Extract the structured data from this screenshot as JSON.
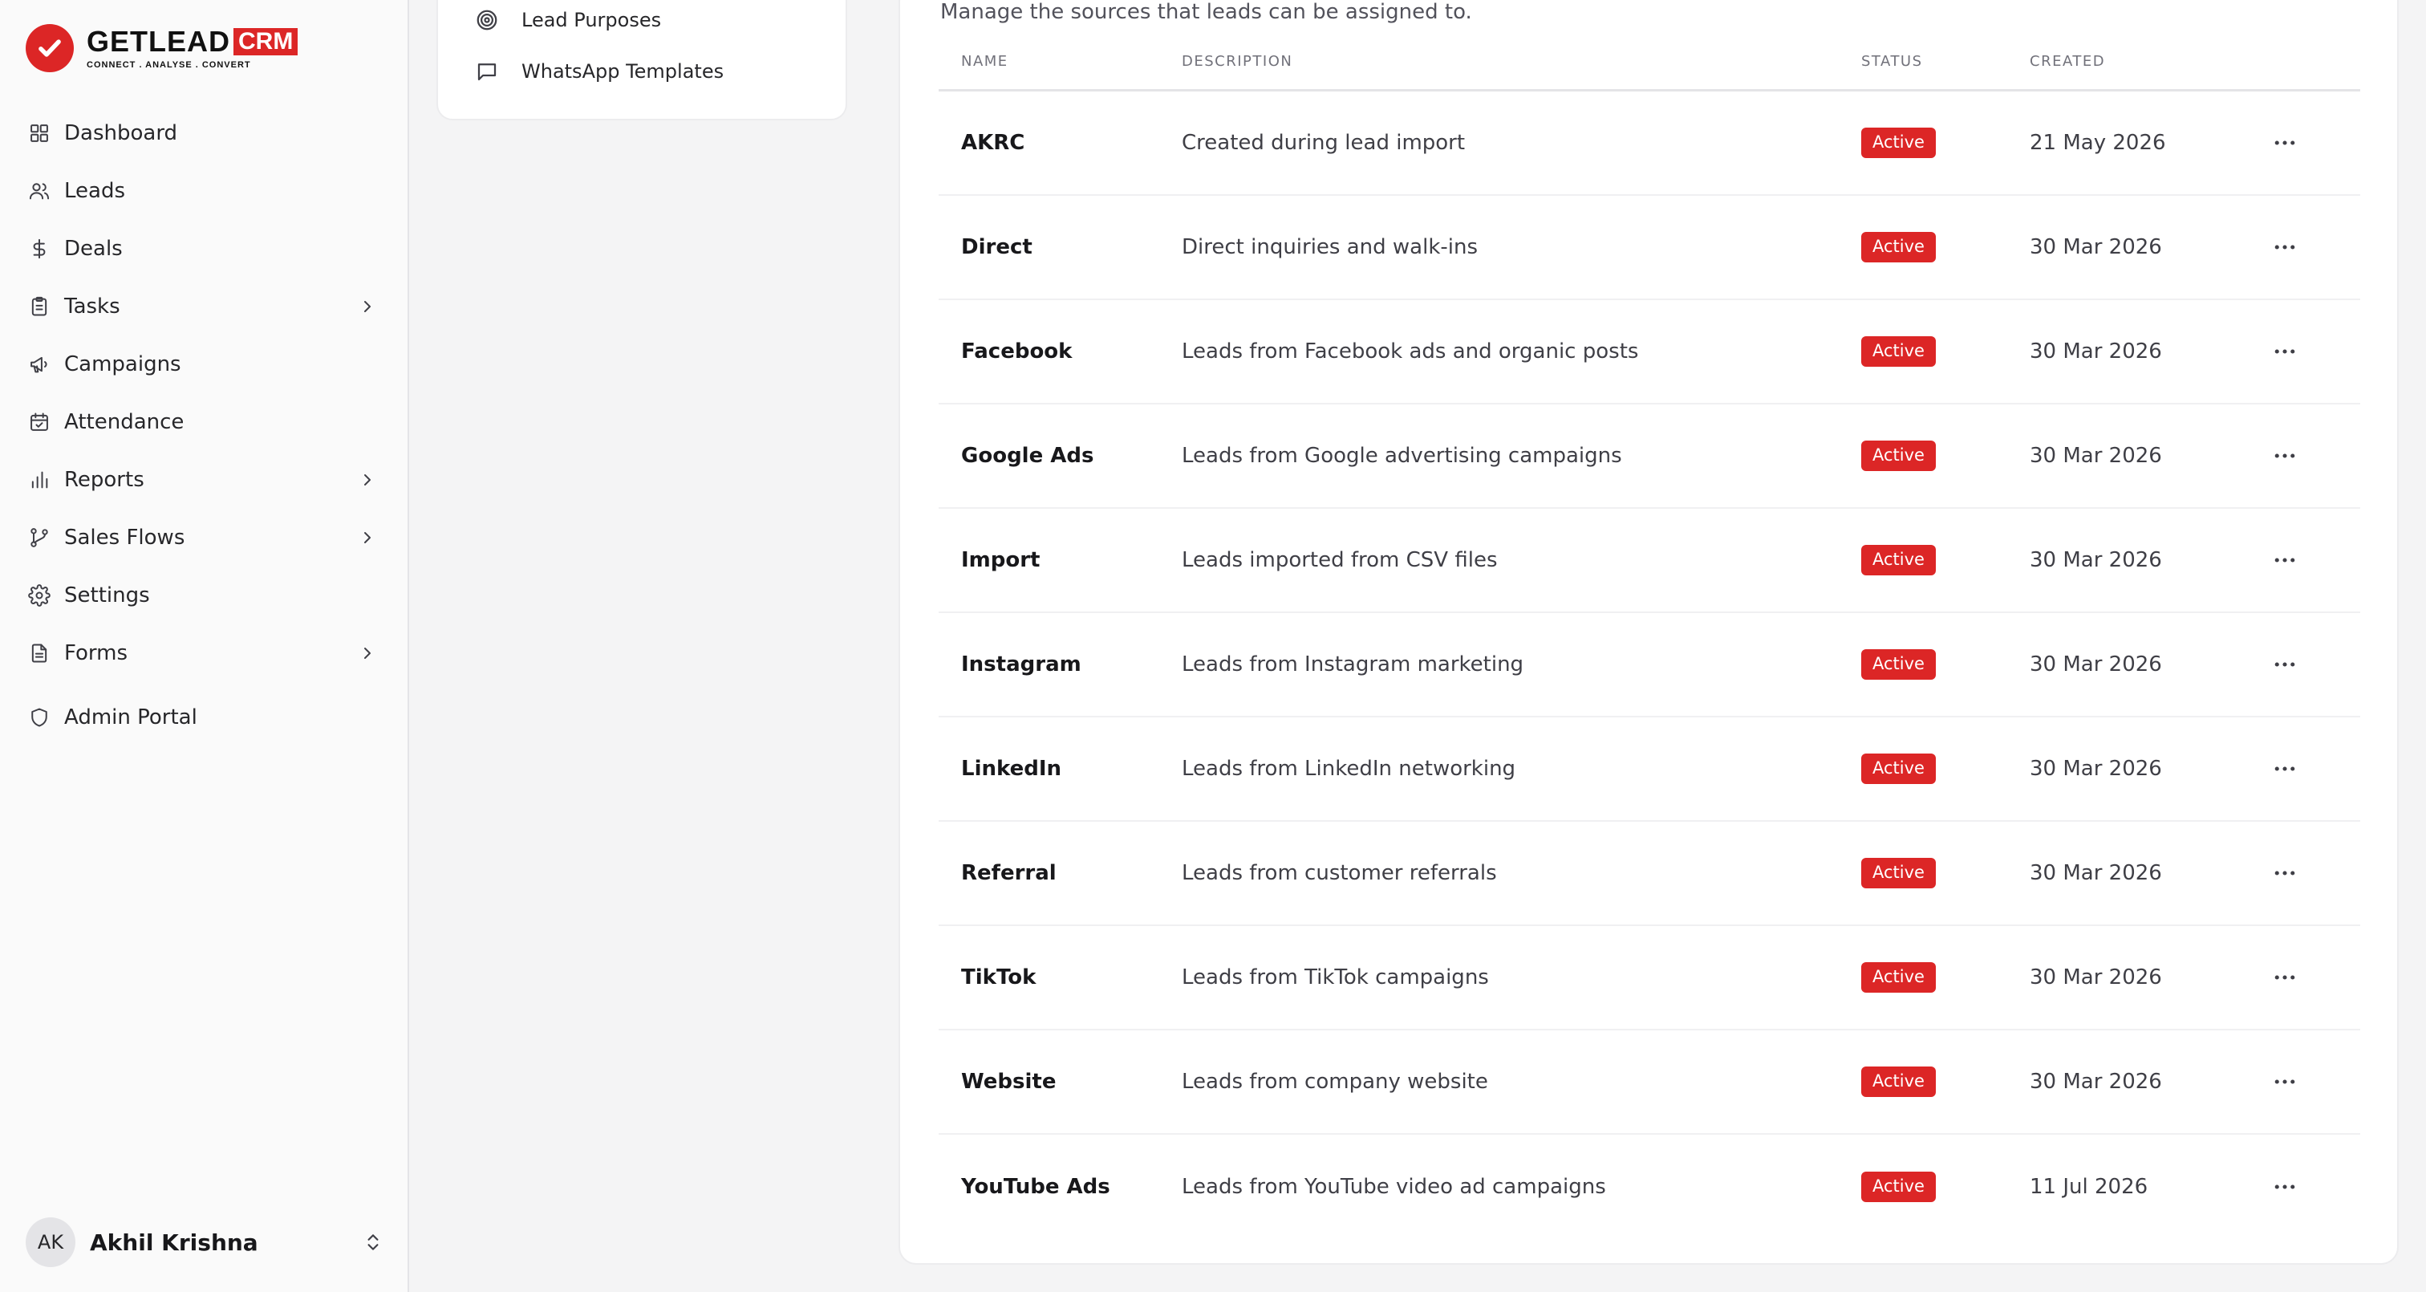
{
  "brand": {
    "name": "GETLEAD",
    "crm": "CRM",
    "tagline": "CONNECT . ANALYSE . CONVERT"
  },
  "sidebar": {
    "items": [
      {
        "label": "Dashboard",
        "icon": "grid-icon",
        "chevron": false
      },
      {
        "label": "Leads",
        "icon": "users-icon",
        "chevron": false
      },
      {
        "label": "Deals",
        "icon": "dollar-icon",
        "chevron": false
      },
      {
        "label": "Tasks",
        "icon": "clipboard-icon",
        "chevron": true
      },
      {
        "label": "Campaigns",
        "icon": "megaphone-icon",
        "chevron": false
      },
      {
        "label": "Attendance",
        "icon": "calendar-check-icon",
        "chevron": false
      },
      {
        "label": "Reports",
        "icon": "bar-chart-icon",
        "chevron": true
      },
      {
        "label": "Sales Flows",
        "icon": "git-branch-icon",
        "chevron": true
      },
      {
        "label": "Settings",
        "icon": "gear-icon",
        "chevron": false
      },
      {
        "label": "Forms",
        "icon": "document-icon",
        "chevron": true
      }
    ],
    "admin_label": "Admin Portal",
    "user": {
      "initials": "AK",
      "name": "Akhil Krishna"
    }
  },
  "subnav": {
    "items": [
      {
        "label": "Lead Purposes",
        "icon": "target-icon"
      },
      {
        "label": "WhatsApp Templates",
        "icon": "message-square-icon"
      }
    ]
  },
  "main": {
    "subtitle": "Manage the sources that leads can be assigned to.",
    "columns": {
      "name": "Name",
      "description": "Description",
      "status": "Status",
      "created": "Created"
    },
    "rows": [
      {
        "name": "AKRC",
        "description": "Created during lead import",
        "status": "Active",
        "created": "21 May 2026"
      },
      {
        "name": "Direct",
        "description": "Direct inquiries and walk-ins",
        "status": "Active",
        "created": "30 Mar 2026"
      },
      {
        "name": "Facebook",
        "description": "Leads from Facebook ads and organic posts",
        "status": "Active",
        "created": "30 Mar 2026"
      },
      {
        "name": "Google Ads",
        "description": "Leads from Google advertising campaigns",
        "status": "Active",
        "created": "30 Mar 2026"
      },
      {
        "name": "Import",
        "description": "Leads imported from CSV files",
        "status": "Active",
        "created": "30 Mar 2026"
      },
      {
        "name": "Instagram",
        "description": "Leads from Instagram marketing",
        "status": "Active",
        "created": "30 Mar 2026"
      },
      {
        "name": "LinkedIn",
        "description": "Leads from LinkedIn networking",
        "status": "Active",
        "created": "30 Mar 2026"
      },
      {
        "name": "Referral",
        "description": "Leads from customer referrals",
        "status": "Active",
        "created": "30 Mar 2026"
      },
      {
        "name": "TikTok",
        "description": "Leads from TikTok campaigns",
        "status": "Active",
        "created": "30 Mar 2026"
      },
      {
        "name": "Website",
        "description": "Leads from company website",
        "status": "Active",
        "created": "30 Mar 2026"
      },
      {
        "name": "YouTube Ads",
        "description": "Leads from YouTube video ad campaigns",
        "status": "Active",
        "created": "11 Jul 2026"
      }
    ]
  },
  "colors": {
    "accent": "#dc2626",
    "sidebar_bg": "#fafafa",
    "page_bg": "#f4f4f5"
  }
}
